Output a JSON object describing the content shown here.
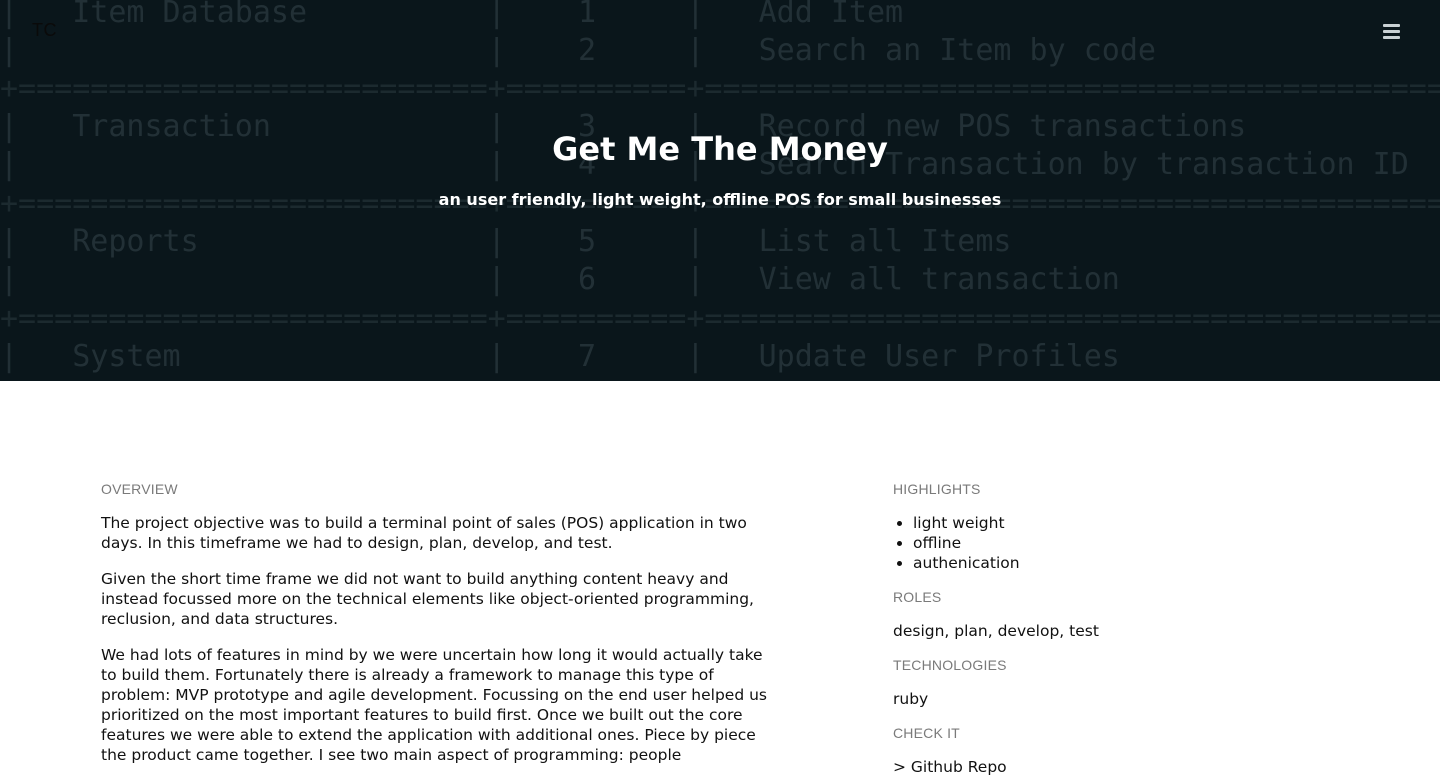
{
  "logo": "TC",
  "hero": {
    "title": "Get Me The Money",
    "subtitle": "an user friendly, light weight, offline POS for small businesses"
  },
  "terminal_lines": [
    "|   Item Database          |    1     |   Add Item                               |",
    "|                          |    2     |   Search an Item by code                 |",
    "+==========================+==========+==========================================+",
    "|   Transaction            |    3     |   Record new POS transactions            |",
    "|                          |    4     |   Search Transaction by transaction ID   |",
    "+==========================+==========+==========================================+",
    "|   Reports                |    5     |   List all Items                         |",
    "|                          |    6     |   View all transaction                   |",
    "+==========================+==========+==========================================+",
    "|   System                 |    7     |   Update User Profiles                   |"
  ],
  "overview": {
    "label": "OVERVIEW",
    "paragraphs": [
      "The project objective was to build a terminal point of sales (POS) application in two days. In this timeframe we had to design, plan, develop, and test.",
      "Given the short time frame we did not want to build anything content heavy and instead focussed more on the technical elements like object-oriented programming, reclusion, and data structures.",
      "We had lots of features in mind by we were uncertain how long it would actually take to build them. Fortunately there is already a framework to manage this type of problem: MVP prototype and agile development. Focussing on the end user helped us prioritized on the most important features to build first. Once we built out the core features we were able to extend the application with additional ones. Piece by piece the product came together. I see two main aspect of programming: people"
    ]
  },
  "highlights": {
    "label": "HIGHLIGHTS",
    "items": [
      "light weight",
      "offline",
      "authenication"
    ]
  },
  "roles": {
    "label": "ROLES",
    "value": "design, plan, develop, test"
  },
  "technologies": {
    "label": "TECHNOLOGIES",
    "value": "ruby"
  },
  "check_it": {
    "label": "CHECK IT",
    "link": "> Github Repo"
  }
}
